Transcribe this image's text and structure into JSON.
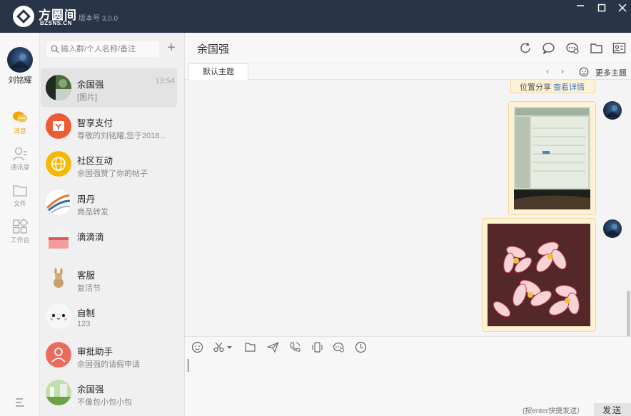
{
  "app": {
    "brand": "方圆间",
    "domain": "BZSNS.CN",
    "version": "版本号 3.0.0",
    "window_controls": [
      "minimize-icon",
      "maximize-icon",
      "close-icon"
    ]
  },
  "nav": {
    "user_name": "刘铭耀",
    "items": [
      {
        "label": "消息",
        "icon": "chat-icon",
        "active": true
      },
      {
        "label": "通讯录",
        "icon": "contacts-icon",
        "active": false
      },
      {
        "label": "文件",
        "icon": "folder-icon",
        "active": false
      },
      {
        "label": "工作台",
        "icon": "apps-icon",
        "active": false
      }
    ],
    "accent": "#f4a300"
  },
  "search": {
    "placeholder": "输入群/个人名称/备注",
    "add_label": "+"
  },
  "conversations": [
    {
      "name": "余国强",
      "preview": "[图片]",
      "time": "13:54",
      "selected": true
    },
    {
      "name": "智享支付",
      "preview": "尊敬的刘铭耀,您于2018...",
      "time": ""
    },
    {
      "name": "社区互动",
      "preview": "余国强赞了你的帖子",
      "time": ""
    },
    {
      "name": "周丹",
      "preview": "商品转发",
      "time": ""
    },
    {
      "name": "滴滴滴",
      "preview": "",
      "time": ""
    },
    {
      "name": "客服",
      "preview": "复活节",
      "time": ""
    },
    {
      "name": "自制",
      "preview": "123",
      "time": ""
    },
    {
      "name": "审批助手",
      "preview": "余国强的请假申请",
      "time": ""
    },
    {
      "name": "余国强",
      "preview": "不像包小包小包",
      "time": ""
    }
  ],
  "chat": {
    "title": "余国强",
    "tabs": [
      {
        "label": "默认主题"
      }
    ],
    "more_topics": "更多主题",
    "location_share": "位置分享",
    "view_details": "查看详情",
    "input_hint": "(按enter快捷发送）",
    "send_label": "发送",
    "bubble_color": "#fdf1d6"
  }
}
